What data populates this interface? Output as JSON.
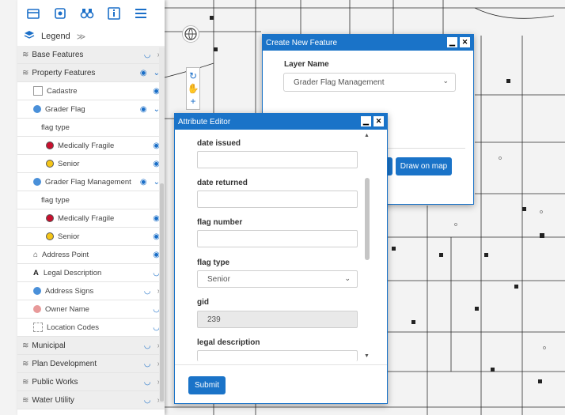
{
  "toolbar": {
    "icons": [
      "layers-box-icon",
      "tools-icon",
      "binoculars-icon",
      "info-icon",
      "menu-icon"
    ]
  },
  "legend": {
    "label": "Legend",
    "collapse": "≫"
  },
  "layers": {
    "base_features": "Base Features",
    "property_features": "Property Features",
    "cadastre": "Cadastre",
    "grader_flag": "Grader Flag",
    "flag_type_1": "flag type",
    "medically_fragile_1": "Medically Fragile",
    "senior_1": "Senior",
    "grader_flag_management": "Grader Flag Management",
    "flag_type_2": "flag type",
    "medically_fragile_2": "Medically Fragile",
    "senior_2": "Senior",
    "address_point": "Address Point",
    "legal_description": "Legal Description",
    "address_signs": "Address Signs",
    "owner_name": "Owner Name",
    "location_codes": "Location Codes",
    "municipal": "Municipal",
    "plan_development": "Plan Development",
    "public_works": "Public Works",
    "water_utility": "Water Utility"
  },
  "create_feature": {
    "title": "Create New Feature",
    "minimize": "▁",
    "close": "✕",
    "layer_name_label": "Layer Name",
    "layer_name_value": "Grader Flag Management",
    "draw_button": "Draw on map"
  },
  "attribute_editor": {
    "title": "Attribute Editor",
    "minimize": "▁",
    "close": "✕",
    "fields": {
      "date_issued": {
        "label": "date issued",
        "value": ""
      },
      "date_returned": {
        "label": "date returned",
        "value": ""
      },
      "flag_number": {
        "label": "flag number",
        "value": ""
      },
      "flag_type": {
        "label": "flag type",
        "value": "Senior"
      },
      "gid": {
        "label": "gid",
        "value": "239"
      },
      "legal_description": {
        "label": "legal description",
        "value": ""
      }
    },
    "submit": "Submit"
  },
  "colors": {
    "accent": "#1a73c8",
    "medically_fragile": "#c8102e",
    "senior": "#f5c518",
    "grader_flag_icon": "#4a90d9"
  }
}
